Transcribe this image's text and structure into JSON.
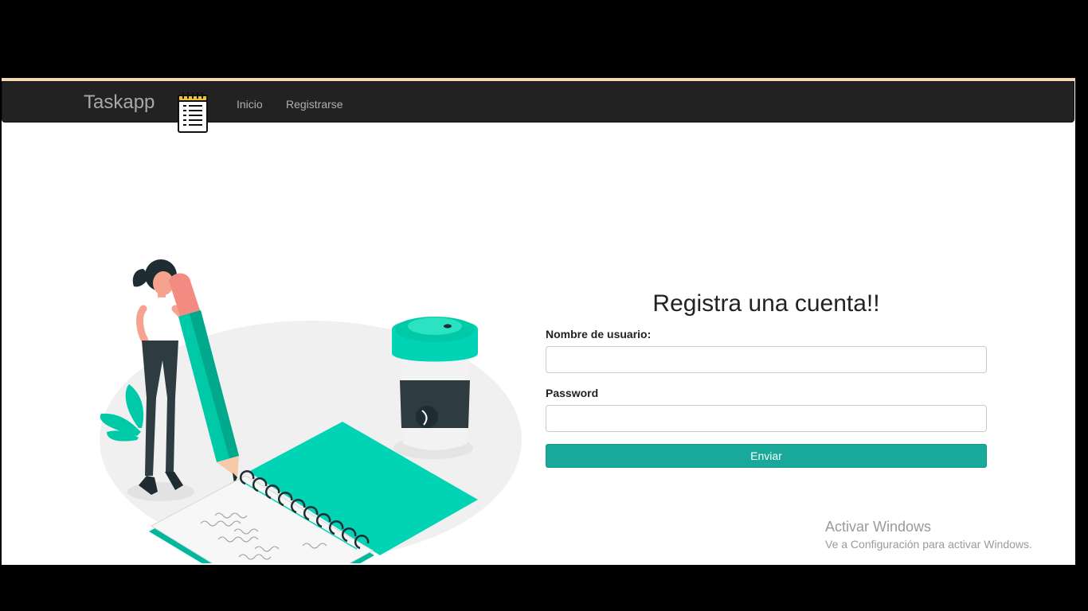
{
  "navbar": {
    "brand": "Taskapp",
    "brand_icon": "notepad-icon",
    "links": [
      {
        "label": "Inicio"
      },
      {
        "label": "Registrarse"
      }
    ]
  },
  "illustration": {
    "subject": "woman-writing-notebook-with-coffee-cup",
    "accent_color": "#00d4b4"
  },
  "form": {
    "title": "Registra una cuenta!!",
    "username_label": "Nombre de usuario:",
    "username_value": "",
    "password_label": "Password",
    "password_value": "",
    "submit_label": "Enviar",
    "submit_color": "#18a99a"
  },
  "watermark": {
    "title": "Activar Windows",
    "subtitle": "Ve a Configuración para activar Windows."
  }
}
